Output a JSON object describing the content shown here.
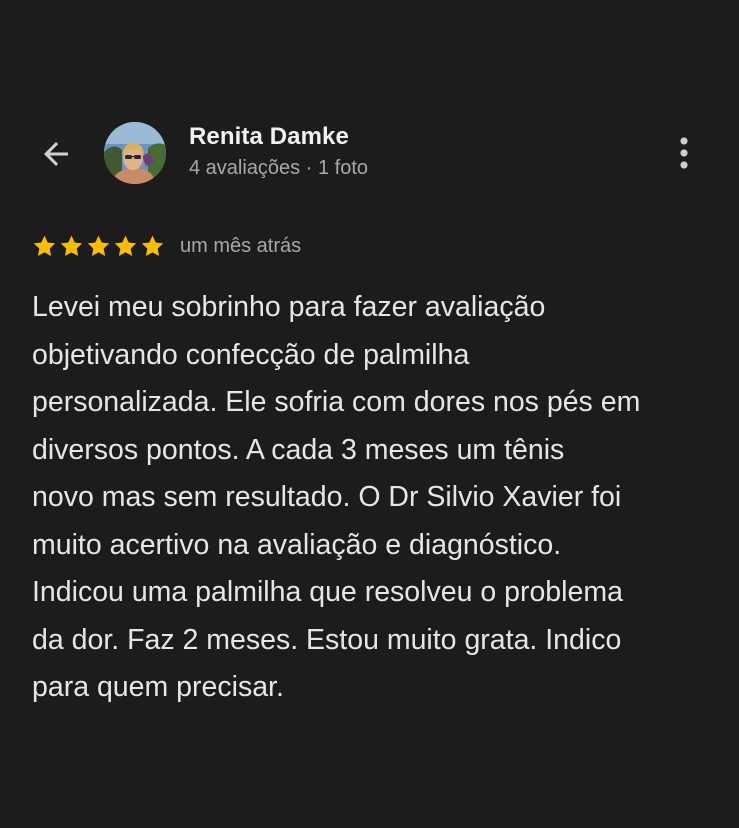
{
  "review": {
    "author_name": "Renita Damke",
    "author_meta": "4 avaliações · 1 foto",
    "rating": 5,
    "rating_max": 5,
    "date": "um mês atrás",
    "text_lines": [
      "Levei meu sobrinho para fazer avaliação",
      "objetivando confecção de palmilha",
      "personalizada. Ele sofria com dores nos pés em",
      "diversos pontos. A cada 3 meses um tênis",
      "novo mas sem resultado. O Dr Silvio Xavier foi",
      "muito acertivo na avaliação e diagnóstico.",
      "Indicou uma palmilha que resolveu o problema",
      "da dor. Faz 2 meses. Estou muito grata. Indico",
      "para quem precisar."
    ]
  },
  "icons": {
    "back": "arrow-back-icon",
    "more": "more-vertical-icon",
    "star": "star-icon"
  },
  "colors": {
    "background": "#1c1c1c",
    "star": "#fbbc04",
    "primary_text": "#e6e6e6",
    "secondary_text": "#a8a8a8"
  }
}
